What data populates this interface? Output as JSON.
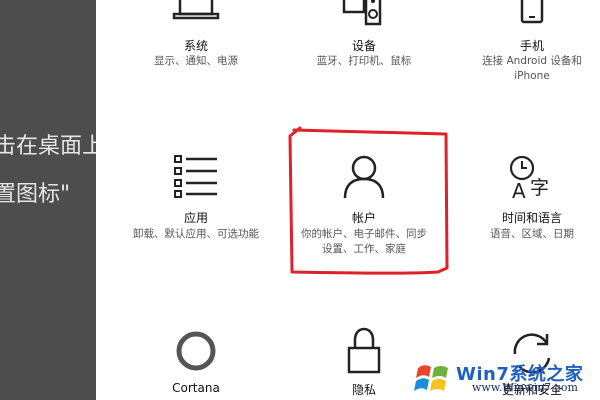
{
  "background": {
    "line1": "击在桌面上",
    "line2": "置图标\""
  },
  "tiles": {
    "system": {
      "title": "系统",
      "desc": "显示、通知、电源",
      "icon": "laptop-icon"
    },
    "devices": {
      "title": "设备",
      "desc": "蓝牙、打印机、鼠标",
      "icon": "devices-icon"
    },
    "phone": {
      "title": "手机",
      "desc1": "连接 Android 设备和",
      "desc2": "iPhone",
      "icon": "phone-icon"
    },
    "apps": {
      "title": "应用",
      "desc": "卸载、默认应用、可选功能",
      "icon": "apps-list-icon"
    },
    "accounts": {
      "title": "帐户",
      "desc1": "你的帐户、电子邮件、同步",
      "desc2": "设置、工作、家庭",
      "icon": "person-icon"
    },
    "time": {
      "title": "时间和语言",
      "desc": "语音、区域、日期",
      "icon": "time-language-icon"
    },
    "cortana": {
      "title": "Cortana",
      "icon": "cortana-icon"
    },
    "privacy": {
      "title": "隐私",
      "icon": "lock-icon"
    },
    "update": {
      "title": "更新和安全",
      "icon": "update-icon"
    }
  },
  "watermark": {
    "brand": "Win7系统之家",
    "url": "www.Winwin7.com"
  },
  "colors": {
    "annotation": "#e0202a",
    "panel": "#4d4d4d"
  }
}
